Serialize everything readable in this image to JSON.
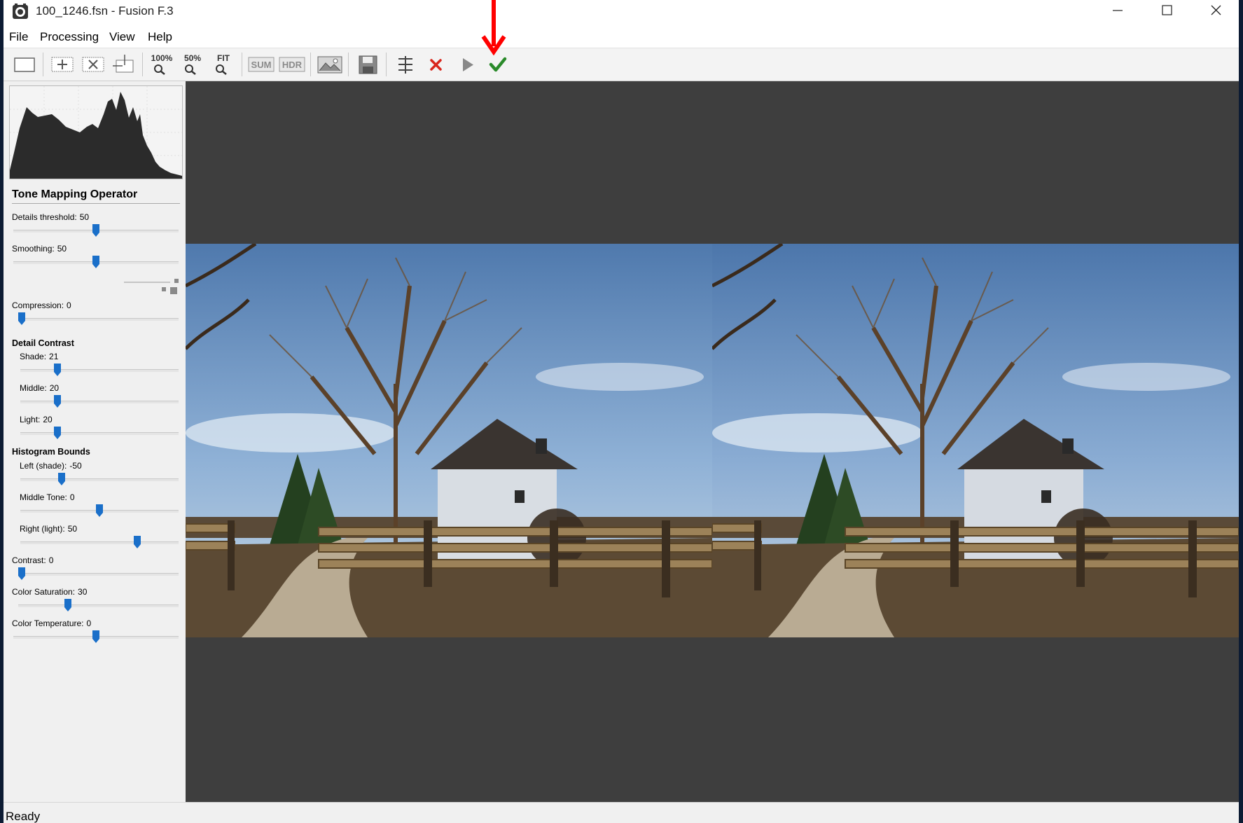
{
  "window": {
    "title": "100_1246.fsn - Fusion F.3"
  },
  "menu": [
    "File",
    "Processing",
    "View",
    "Help"
  ],
  "toolbar": {
    "zoom_100": "100%",
    "zoom_50": "50%",
    "zoom_fit": "FIT",
    "sum": "SUM",
    "hdr": "HDR"
  },
  "panel": {
    "tmo_title": "Tone Mapping Operator",
    "detail_contrast_title": "Detail Contrast",
    "histogram_bounds_title": "Histogram Bounds",
    "sliders": {
      "details_threshold": {
        "label": "Details threshold:",
        "value": "50",
        "level": 0.5
      },
      "smoothing": {
        "label": "Smoothing:",
        "value": "50",
        "level": 0.5
      },
      "compression": {
        "label": "Compression:",
        "value": "0",
        "level": 0.0
      },
      "shade": {
        "label": "Shade:",
        "value": "21",
        "level": 0.22
      },
      "middle": {
        "label": "Middle:",
        "value": "20",
        "level": 0.22
      },
      "light": {
        "label": "Light:",
        "value": "20",
        "level": 0.22
      },
      "left_shade": {
        "label": "Left (shade):",
        "value": "-50",
        "level": 0.25
      },
      "middle_tone": {
        "label": "Middle Tone:",
        "value": "0",
        "level": 0.5
      },
      "right_light": {
        "label": "Right (light):",
        "value": "50",
        "level": 0.75
      },
      "contrast": {
        "label": "Contrast:",
        "value": "0",
        "level": 0.0
      },
      "color_saturation": {
        "label": "Color Saturation:",
        "value": "30",
        "level": 0.3
      },
      "color_temperature": {
        "label": "Color Temperature:",
        "value": "0",
        "level": 0.5
      }
    }
  },
  "status": {
    "text": "Ready"
  },
  "colors": {
    "accent": "#1a6fc9",
    "viewer_bg": "#3e3e3e",
    "cancel": "#d9261c",
    "apply": "#2a8a2a",
    "annotation": "#ff0000"
  }
}
